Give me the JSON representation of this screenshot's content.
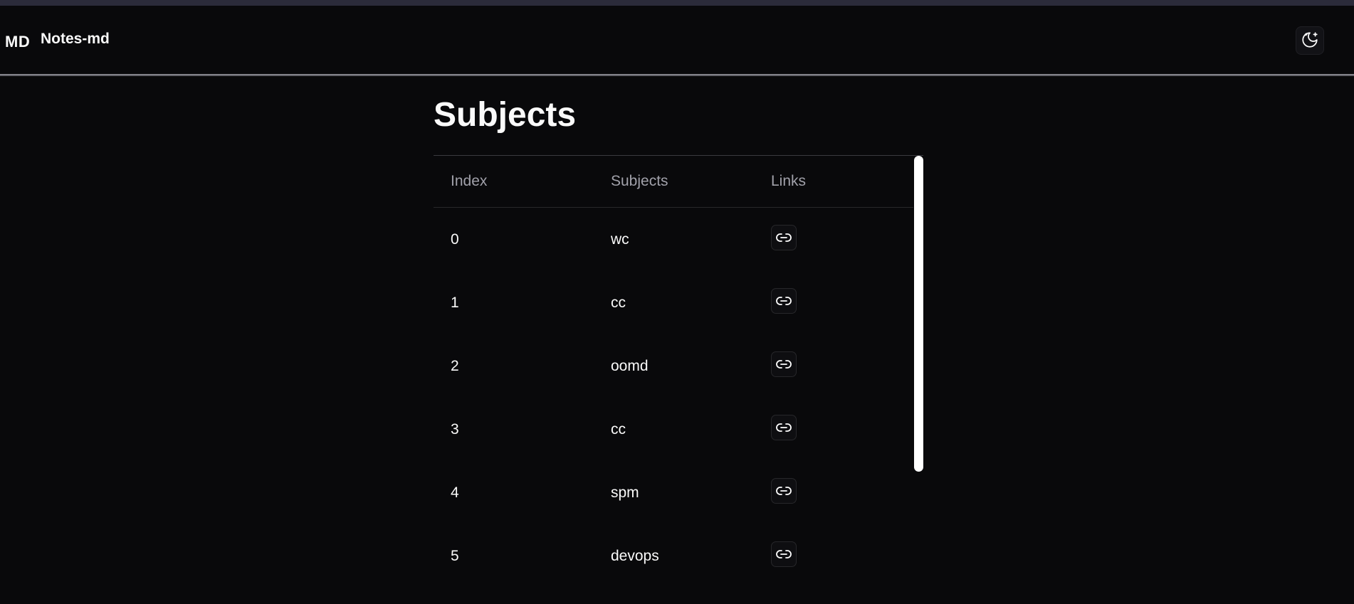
{
  "header": {
    "logo": "MD",
    "app_name": "Notes-md",
    "theme_toggle_icon": "moon-stars-icon"
  },
  "main": {
    "title": "Subjects",
    "table": {
      "columns": [
        "Index",
        "Subjects",
        "Links"
      ],
      "rows": [
        {
          "index": "0",
          "subject": "wc",
          "link_icon": "link-icon"
        },
        {
          "index": "1",
          "subject": "cc",
          "link_icon": "link-icon"
        },
        {
          "index": "2",
          "subject": "oomd",
          "link_icon": "link-icon"
        },
        {
          "index": "3",
          "subject": "cc",
          "link_icon": "link-icon"
        },
        {
          "index": "4",
          "subject": "spm",
          "link_icon": "link-icon"
        },
        {
          "index": "5",
          "subject": "devops",
          "link_icon": "link-icon"
        }
      ]
    }
  },
  "colors": {
    "background": "#09090b",
    "text": "#fafafa",
    "muted_text": "#a1a1aa",
    "border": "#27272a"
  }
}
